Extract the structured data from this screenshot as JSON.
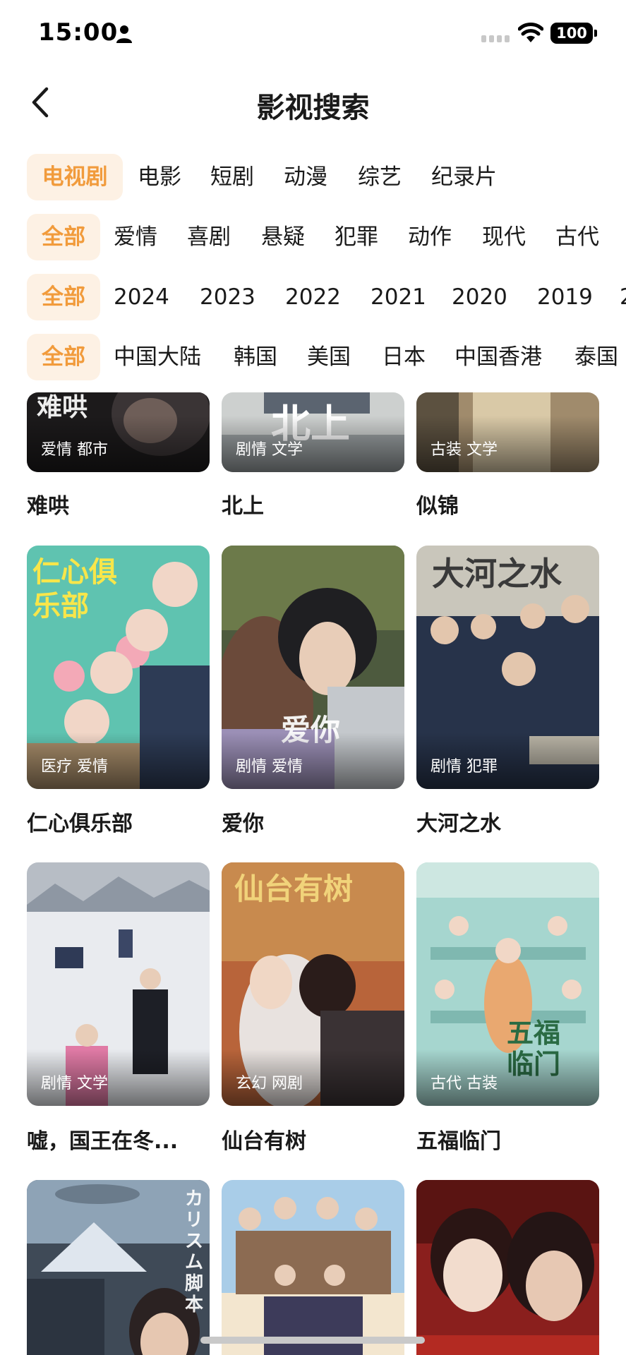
{
  "status_bar": {
    "time": "15:00",
    "battery": "100"
  },
  "header": {
    "title": "影视搜索"
  },
  "filters": {
    "type": [
      "电视剧",
      "电影",
      "短剧",
      "动漫",
      "综艺",
      "纪录片"
    ],
    "genre": [
      "全部",
      "爱情",
      "喜剧",
      "悬疑",
      "犯罪",
      "动作",
      "现代",
      "古代"
    ],
    "year": [
      "全部",
      "2024",
      "2023",
      "2022",
      "2021",
      "2020",
      "2019",
      "2"
    ],
    "region": [
      "全部",
      "中国大陆",
      "韩国",
      "美国",
      "日本",
      "中国香港",
      "泰国"
    ]
  },
  "accent_color": "#f19b3c",
  "accent_bg": "#fdf1e4",
  "cards": [
    {
      "title": "难哄",
      "tags": "爱情 都市",
      "poster_text": "难哄"
    },
    {
      "title": "北上",
      "tags": "剧情 文学",
      "poster_text": "北上"
    },
    {
      "title": "似锦",
      "tags": "古装 文学",
      "poster_text": ""
    },
    {
      "title": "仁心俱乐部",
      "tags": "医疗 爱情",
      "poster_text": "仁心俱乐部"
    },
    {
      "title": "爱你",
      "tags": "剧情 爱情",
      "poster_text": "爱你"
    },
    {
      "title": "大河之水",
      "tags": "剧情 犯罪",
      "poster_text": "大河之水"
    },
    {
      "title": "嘘，国王在冬...",
      "tags": "剧情 文学",
      "poster_text": ""
    },
    {
      "title": "仙台有树",
      "tags": "玄幻 网剧",
      "poster_text": "仙台有树"
    },
    {
      "title": "五福临门",
      "tags": "古代 古装",
      "poster_text": "五福临门"
    },
    {
      "title": "",
      "tags": "",
      "poster_text": "カリスム脚本"
    },
    {
      "title": "",
      "tags": "",
      "poster_text": ""
    },
    {
      "title": "",
      "tags": "",
      "poster_text": ""
    }
  ]
}
